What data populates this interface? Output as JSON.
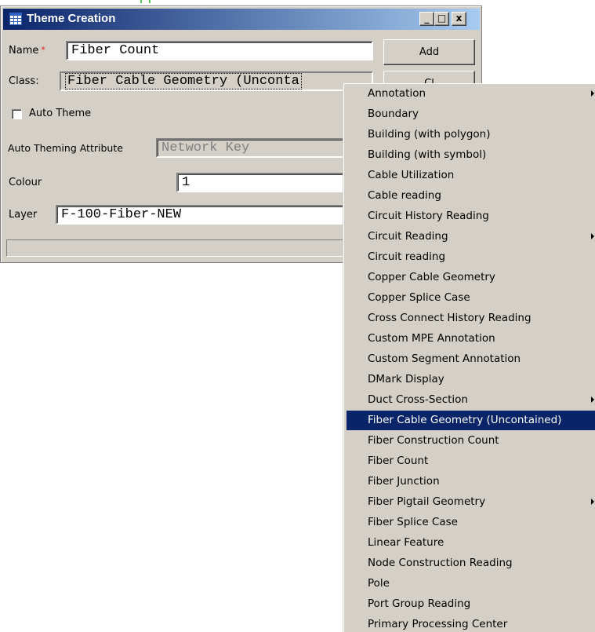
{
  "window": {
    "title": "Theme Creation",
    "controls": {
      "minimize": "_",
      "maximize": "□",
      "close": "x"
    },
    "title_gradient": [
      "#0a246a",
      "#a6caf0"
    ]
  },
  "form": {
    "name_label": "Name",
    "required_mark": "*",
    "name_value": "Fiber Count",
    "class_label": "Class:",
    "class_value": "Fiber Cable Geometry (Unconta",
    "auto_theme_label": "Auto Theme",
    "auto_theme_checked": false,
    "auto_attr_label": "Auto Theming Attribute",
    "auto_attr_value": "Network Key",
    "colour_label": "Colour",
    "colour_value": "1",
    "layer_label": "Layer",
    "layer_value": "F-100-Fiber-NEW"
  },
  "buttons": {
    "add": "Add",
    "second": "Cl"
  },
  "menu": {
    "selected_color": "#0a246a",
    "items": [
      {
        "label": "Annotation",
        "submenu": true
      },
      {
        "label": "Boundary",
        "submenu": false
      },
      {
        "label": "Building (with polygon)",
        "submenu": false
      },
      {
        "label": "Building (with symbol)",
        "submenu": false
      },
      {
        "label": "Cable Utilization",
        "submenu": false
      },
      {
        "label": "Cable reading",
        "submenu": false
      },
      {
        "label": "Circuit History Reading",
        "submenu": false
      },
      {
        "label": "Circuit Reading",
        "submenu": true
      },
      {
        "label": "Circuit reading",
        "submenu": false
      },
      {
        "label": "Copper Cable Geometry",
        "submenu": false
      },
      {
        "label": "Copper Splice Case",
        "submenu": false
      },
      {
        "label": "Cross Connect History Reading",
        "submenu": false
      },
      {
        "label": "Custom MPE Annotation",
        "submenu": false
      },
      {
        "label": "Custom Segment Annotation",
        "submenu": false
      },
      {
        "label": "DMark Display",
        "submenu": false
      },
      {
        "label": "Duct Cross-Section",
        "submenu": true
      },
      {
        "label": "Fiber Cable Geometry (Uncontained)",
        "submenu": false,
        "selected": true
      },
      {
        "label": "Fiber Construction Count",
        "submenu": false
      },
      {
        "label": "Fiber Count",
        "submenu": false
      },
      {
        "label": "Fiber Junction",
        "submenu": false
      },
      {
        "label": "Fiber Pigtail Geometry",
        "submenu": true
      },
      {
        "label": "Fiber Splice Case",
        "submenu": false
      },
      {
        "label": "Linear Feature",
        "submenu": false
      },
      {
        "label": "Node Construction Reading",
        "submenu": false
      },
      {
        "label": "Pole",
        "submenu": false
      },
      {
        "label": "Port Group Reading",
        "submenu": false
      },
      {
        "label": "Primary Processing Center",
        "submenu": false
      }
    ]
  }
}
